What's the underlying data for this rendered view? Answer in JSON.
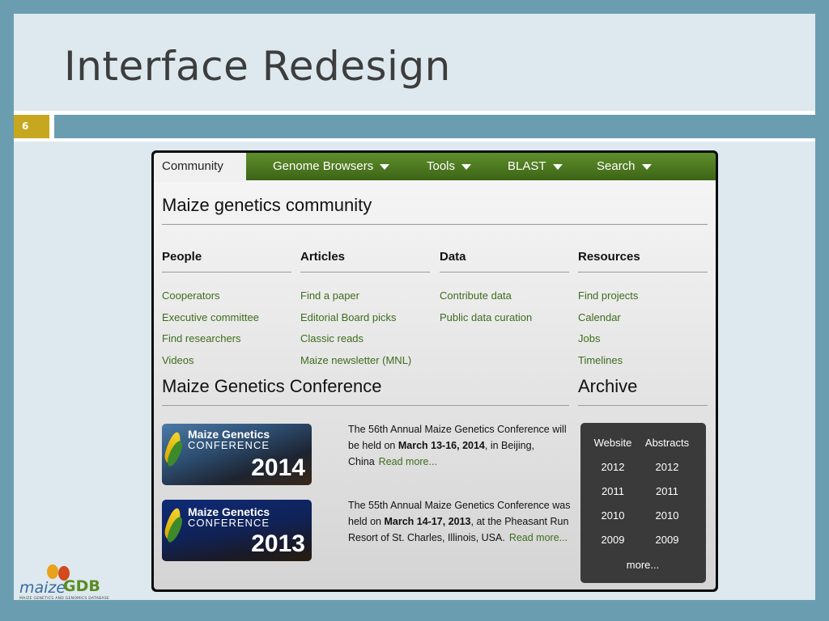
{
  "slide": {
    "title": "Interface Redesign",
    "number": "6",
    "colors": {
      "background": "#6b9db0",
      "slide": "#dde9ee",
      "number_badge": "#c7a71f"
    }
  },
  "nav": {
    "items": [
      {
        "label": "Community",
        "active": true
      },
      {
        "label": "Genome Browsers",
        "dropdown": true
      },
      {
        "label": "Tools",
        "dropdown": true
      },
      {
        "label": "BLAST",
        "dropdown": true
      },
      {
        "label": "Search",
        "dropdown": true
      }
    ],
    "color": "#4a7a20"
  },
  "page": {
    "heading": "Maize genetics community",
    "columns": [
      {
        "title": "People",
        "links": [
          "Cooperators",
          "Executive committee",
          "Find researchers",
          "Videos"
        ]
      },
      {
        "title": "Articles",
        "links": [
          "Find a paper",
          "Editorial Board picks",
          "Classic reads",
          "Maize newsletter (MNL)"
        ]
      },
      {
        "title": "Data",
        "links": [
          "Contribute data",
          "Public data curation"
        ]
      },
      {
        "title": "Resources",
        "links": [
          "Find projects",
          "Calendar",
          "Jobs",
          "Timelines"
        ]
      }
    ]
  },
  "conference": {
    "heading": "Maize Genetics Conference",
    "items": [
      {
        "brand": "Maize Genetics",
        "brand2": "CONFERENCE",
        "year": "2014",
        "text_before": "The 56th Annual Maize Genetics Conference will be held on ",
        "dates": "March 13-16, 2014",
        "text_after": ", in Beijing, China",
        "read_more": "Read more..."
      },
      {
        "brand": "Maize Genetics",
        "brand2": "CONFERENCE",
        "year": "2013",
        "text_before": "The 55th Annual Maize Genetics Conference was held on ",
        "dates": "March 14-17, 2013",
        "text_after": ", at the Pheasant Run Resort of St. Charles, Illinois, USA.",
        "read_more": "Read more..."
      }
    ]
  },
  "archive": {
    "heading": "Archive",
    "col_headers": [
      "Website",
      "Abstracts"
    ],
    "years": [
      "2012",
      "2011",
      "2010",
      "2009"
    ],
    "more": "more..."
  },
  "logo": {
    "part1": "maize",
    "part2": "GDB",
    "subtitle": "MAIZE GENETICS AND GENOMICS DATABASE"
  }
}
